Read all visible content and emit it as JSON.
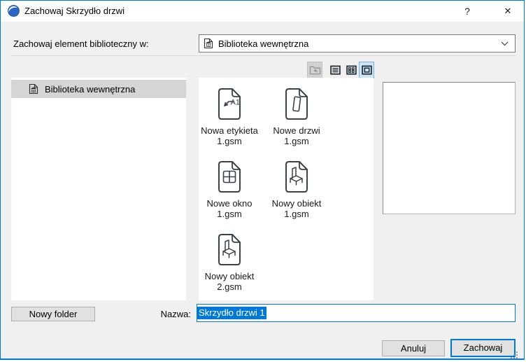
{
  "window": {
    "title": "Zachowaj Skrzydło drzwi",
    "help_label": "?",
    "close_label": "✕"
  },
  "header": {
    "save_to_label": "Zachowaj element biblioteczny w:",
    "library_select": {
      "value": "Biblioteka wewnętrzna"
    }
  },
  "toolbar": {
    "buttons": [
      {
        "name": "folder-up",
        "state": "disabled"
      },
      {
        "name": "list-view",
        "state": "normal"
      },
      {
        "name": "small-icons-view",
        "state": "normal"
      },
      {
        "name": "large-icons-view",
        "state": "selected"
      }
    ]
  },
  "sidebar": {
    "items": [
      {
        "label": "Biblioteka wewnętrzna",
        "selected": true
      }
    ]
  },
  "files": [
    {
      "name": "Nowa etykieta",
      "file": "1.gsm",
      "type": "label"
    },
    {
      "name": "Nowe drzwi",
      "file": "1.gsm",
      "type": "door"
    },
    {
      "name": "Nowe okno",
      "file": "1.gsm",
      "type": "window"
    },
    {
      "name": "Nowy obiekt",
      "file": "1.gsm",
      "type": "object"
    },
    {
      "name": "Nowy obiekt",
      "file": "2.gsm",
      "type": "object"
    }
  ],
  "footer": {
    "new_folder_label": "Nowy folder",
    "name_label": "Nazwa:",
    "name_value": "Skrzydło drzwi 1",
    "cancel_label": "Anuluj",
    "save_label": "Zachowaj"
  },
  "colors": {
    "accent": "#0078d7",
    "selection": "#0078d7",
    "toolbar_selected_bg": "#cce4f7",
    "dialog_bg": "#f0f0f0"
  }
}
